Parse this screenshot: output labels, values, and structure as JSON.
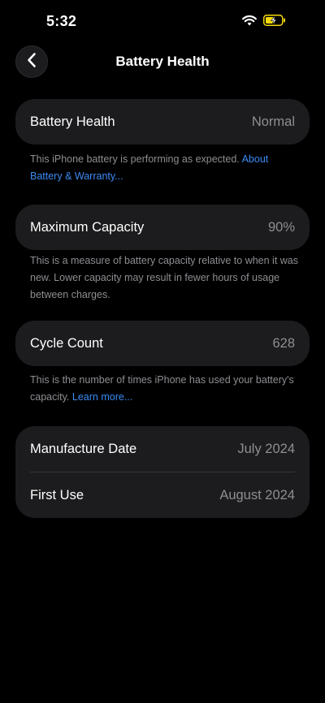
{
  "status_bar": {
    "time": "5:32"
  },
  "nav": {
    "title": "Battery Health"
  },
  "battery_health": {
    "label": "Battery Health",
    "value": "Normal",
    "note": "This iPhone battery is performing as expected.",
    "link": "About Battery & Warranty..."
  },
  "maximum_capacity": {
    "label": "Maximum Capacity",
    "value": "90%",
    "note": "This is a measure of battery capacity relative to when it was new. Lower capacity may result in fewer hours of usage between charges."
  },
  "cycle_count": {
    "label": "Cycle Count",
    "value": "628",
    "note": "This is the number of times iPhone has used your battery's capacity.",
    "link": "Learn more..."
  },
  "dates": {
    "manufacture_label": "Manufacture Date",
    "manufacture_value": "July 2024",
    "first_use_label": "First Use",
    "first_use_value": "August 2024"
  },
  "icons": {
    "wifi": "wifi-icon",
    "battery": "battery-charging-icon",
    "back": "chevron-left-icon"
  },
  "colors": {
    "background": "#000000",
    "card": "#1c1c1e",
    "secondary_text": "#8e8e93",
    "link": "#3a8cf5",
    "battery_charging": "#f5d90a"
  }
}
